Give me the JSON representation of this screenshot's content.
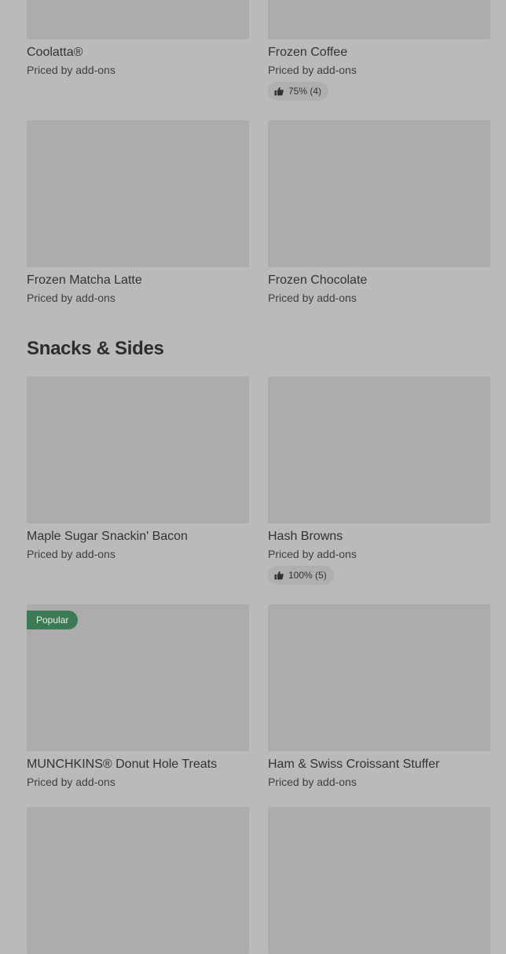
{
  "top_items": [
    {
      "name": "Coolatta®",
      "price": "Priced by add-ons"
    },
    {
      "name": "Frozen Coffee",
      "price": "Priced by add-ons",
      "rating": "75% (4)"
    },
    {
      "name": "Frozen Matcha Latte",
      "price": "Priced by add-ons"
    },
    {
      "name": "Frozen Chocolate",
      "price": "Priced by add-ons"
    }
  ],
  "snacks_section": {
    "title": "Snacks & Sides",
    "items": [
      {
        "name": "Maple Sugar Snackin' Bacon",
        "price": "Priced by add-ons"
      },
      {
        "name": "Hash Browns",
        "price": "Priced by add-ons",
        "rating": "100% (5)"
      },
      {
        "name": "MUNCHKINS® Donut Hole Treats",
        "price": "Priced by add-ons",
        "badge": "Popular"
      },
      {
        "name": "Ham & Swiss Croissant Stuffer",
        "price": "Priced by add-ons"
      }
    ]
  },
  "colors": {
    "background": "#bababa",
    "thumbnail": "#acacac",
    "badge": "#3c7a55"
  },
  "icons": {
    "rating": "thumbs-up-icon"
  }
}
